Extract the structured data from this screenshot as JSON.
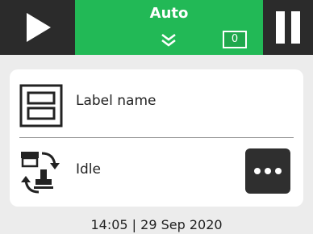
{
  "header": {
    "mode_label": "Auto",
    "counter_value": "0",
    "play_icon": "play-icon",
    "pause_icon": "pause-icon",
    "expand_icon": "chevron-double-down-icon",
    "accent_color": "#22b956",
    "button_color": "#2b2b2b"
  },
  "card": {
    "label_icon": "label-layout-icon",
    "label_name": "Label name",
    "status_icon": "printer-idle-icon",
    "status_text": "Idle",
    "more_icon": "more-dots-icon"
  },
  "footer": {
    "time": "14:05",
    "separator": "|",
    "date": "29 Sep 2020"
  }
}
